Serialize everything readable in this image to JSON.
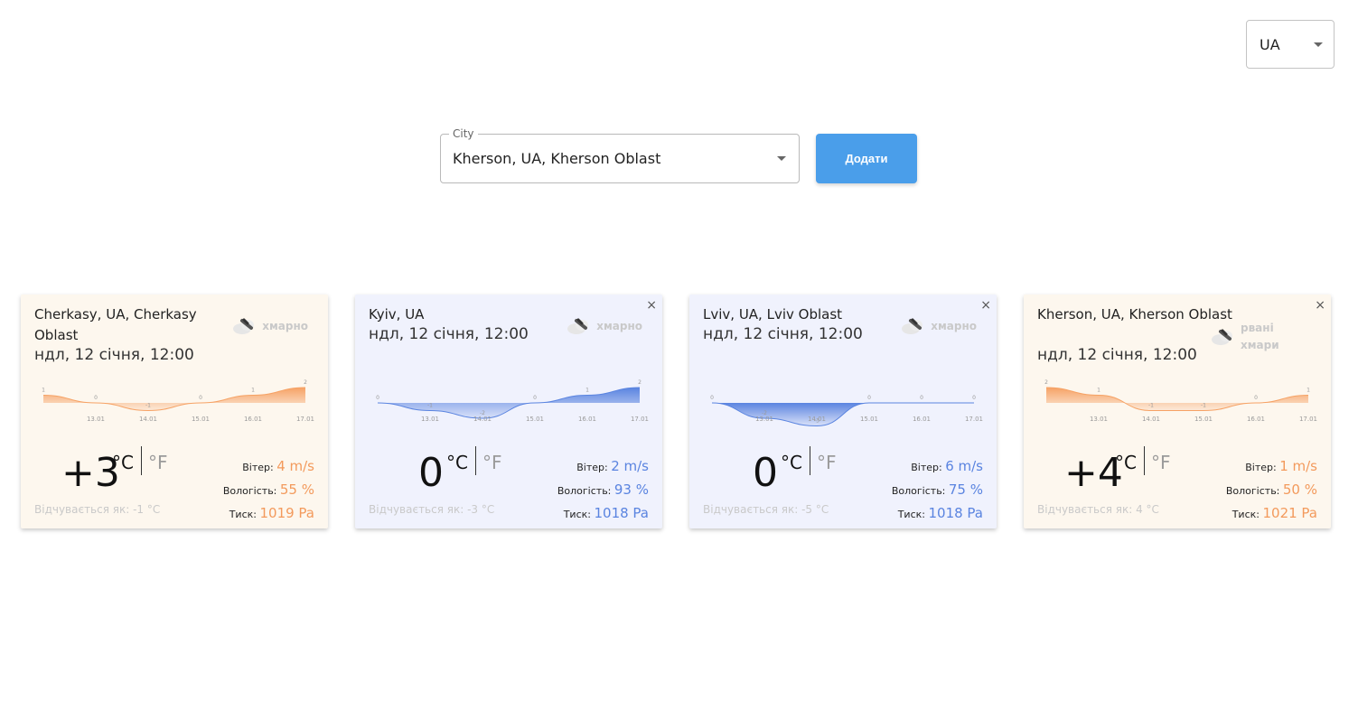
{
  "lang_select": {
    "value": "UA"
  },
  "city_field": {
    "label": "City",
    "value": "Kherson, UA, Kherson Oblast"
  },
  "add_button": {
    "label": "Додати"
  },
  "labels": {
    "celsius": "°C",
    "fahrenheit": "°F",
    "wind": "Вітер:",
    "humidity": "Вологість:",
    "pressure": "Тиск:",
    "close": "×"
  },
  "cards": [
    {
      "city": "Cherkasy, UA, Cherkasy Oblast",
      "date": "ндл, 12 січня, 12:00",
      "weather": "хмарно",
      "temp": "+3",
      "feels_like": "Відчувається як: -1 °C",
      "wind": "4 m/s",
      "humidity": "55 %",
      "pressure": "1019 Pa",
      "theme": "warm",
      "closable": false,
      "chart_data": {
        "type": "area",
        "x": [
          "",
          "13.01",
          "14.01",
          "15.01",
          "16.01",
          "17.01"
        ],
        "values": [
          1,
          0,
          -1,
          0,
          1,
          2
        ],
        "color": "#f6a265"
      }
    },
    {
      "city": "Kyiv, UA",
      "date": "ндл, 12 січня, 12:00",
      "weather": "хмарно",
      "temp": "0",
      "feels_like": "Відчувається як: -3 °C",
      "wind": "2 m/s",
      "humidity": "93 %",
      "pressure": "1018 Pa",
      "theme": "cold",
      "closable": true,
      "chart_data": {
        "type": "area",
        "x": [
          "",
          "13.01",
          "14.01",
          "15.01",
          "16.01",
          "17.01"
        ],
        "values": [
          0,
          -1,
          -2,
          0,
          1,
          2
        ],
        "color": "#5a84e0"
      }
    },
    {
      "city": "Lviv, UA, Lviv Oblast",
      "date": "ндл, 12 січня, 12:00",
      "weather": "хмарно",
      "temp": "0",
      "feels_like": "Відчувається як: -5 °C",
      "wind": "6 m/s",
      "humidity": "75 %",
      "pressure": "1018 Pa",
      "theme": "cold",
      "closable": true,
      "chart_data": {
        "type": "area",
        "x": [
          "",
          "13.01",
          "14.01",
          "15.01",
          "16.01",
          "17.01"
        ],
        "values": [
          0,
          -2,
          -3,
          0,
          0,
          0
        ],
        "color": "#5a84e0"
      }
    },
    {
      "city": "Kherson, UA, Kherson Oblast",
      "date": "ндл, 12 січня, 12:00",
      "weather": "рвані хмари",
      "temp": "+4",
      "feels_like": "Відчувається як: 4 °C",
      "wind": "1 m/s",
      "humidity": "50 %",
      "pressure": "1021 Pa",
      "theme": "warm",
      "closable": true,
      "chart_data": {
        "type": "area",
        "x": [
          "",
          "13.01",
          "14.01",
          "15.01",
          "16.01",
          "17.01"
        ],
        "values": [
          2,
          1,
          -1,
          -1,
          0,
          1
        ],
        "color": "#f6a265"
      }
    }
  ]
}
